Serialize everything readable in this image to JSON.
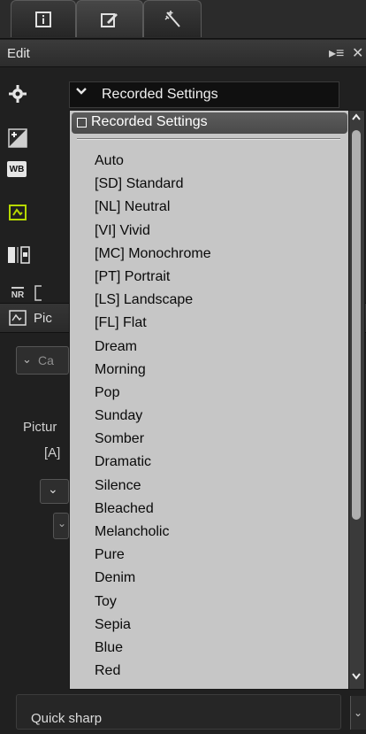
{
  "tabs": [
    {
      "icon": "info-icon"
    },
    {
      "icon": "edit-icon"
    },
    {
      "icon": "effects-icon"
    }
  ],
  "header": {
    "title": "Edit",
    "menu_glyph": "▸≡",
    "close_glyph": "✕"
  },
  "toolbar": {
    "wb_label": "WB",
    "nr_label": "NR"
  },
  "dropdown": {
    "current_value": "Recorded Settings",
    "selected_item": "Recorded Settings",
    "items": [
      "Auto",
      "[SD] Standard",
      "[NL] Neutral",
      "[VI] Vivid",
      "[MC] Monochrome",
      "[PT] Portrait",
      "[LS] Landscape",
      "[FL] Flat",
      "Dream",
      "Morning",
      "Pop",
      "Sunday",
      "Somber",
      "Dramatic",
      "Silence",
      "Bleached",
      "Melancholic",
      "Pure",
      "Denim",
      "Toy",
      "Sepia",
      "Blue",
      "Red"
    ]
  },
  "underlying": {
    "panel_title_partial": "Pic",
    "dropdown_partial": "Ca",
    "picture_label_partial": "Pictur",
    "a_label": "[A]"
  },
  "bottom": {
    "quick_sharp_label": "Quick sharp"
  },
  "colors": {
    "list_background": "#c6c6c6",
    "selected_background": "#555555",
    "panel_background": "#202020"
  }
}
